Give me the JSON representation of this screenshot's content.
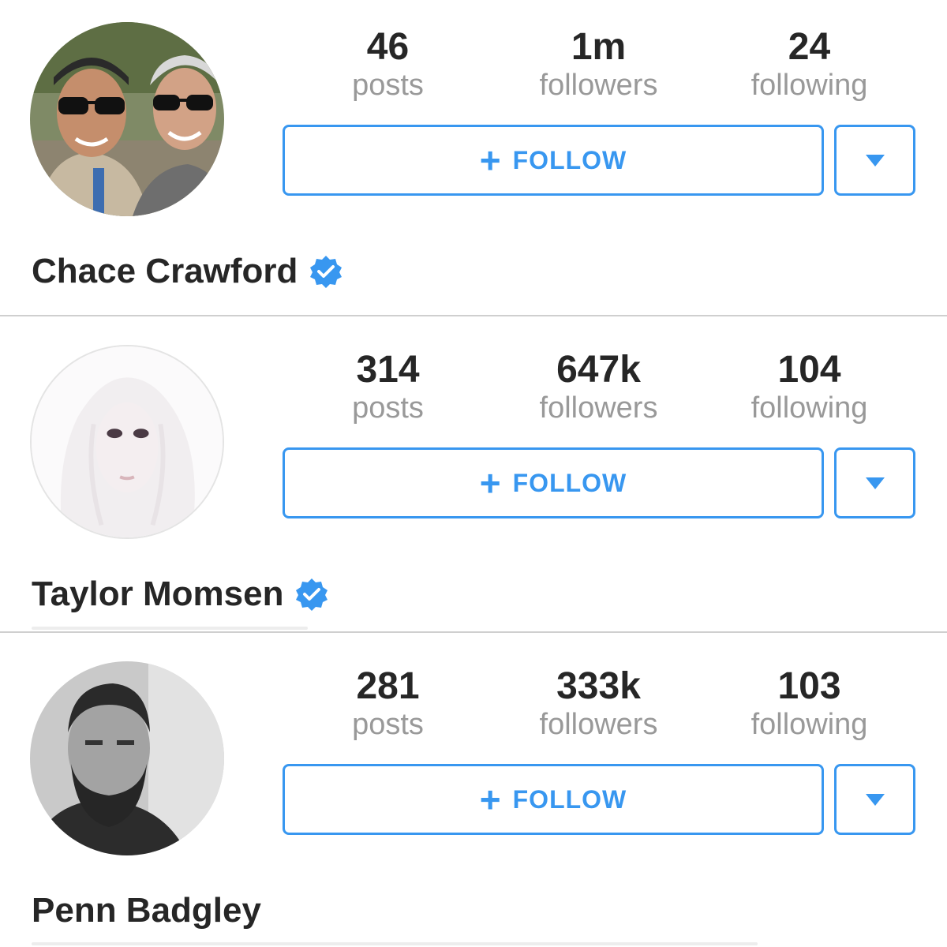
{
  "accent_color": "#3897f0",
  "profiles": [
    {
      "name": "Chace Crawford",
      "verified": true,
      "avatar_icon": "avatar-photo-two-men-sunglasses",
      "stats": [
        {
          "value": "46",
          "label": "posts"
        },
        {
          "value": "1m",
          "label": "followers"
        },
        {
          "value": "24",
          "label": "following"
        }
      ],
      "follow_label": "FOLLOW",
      "follow_icon": "plus-icon",
      "dropdown_icon": "caret-down-icon"
    },
    {
      "name": "Taylor Momsen",
      "verified": true,
      "avatar_icon": "avatar-photo-blonde-woman",
      "stats": [
        {
          "value": "314",
          "label": "posts"
        },
        {
          "value": "647k",
          "label": "followers"
        },
        {
          "value": "104",
          "label": "following"
        }
      ],
      "follow_label": "FOLLOW",
      "follow_icon": "plus-icon",
      "dropdown_icon": "caret-down-icon"
    },
    {
      "name": "Penn Badgley",
      "verified": false,
      "avatar_icon": "avatar-photo-bearded-man-bw",
      "stats": [
        {
          "value": "281",
          "label": "posts"
        },
        {
          "value": "333k",
          "label": "followers"
        },
        {
          "value": "103",
          "label": "following"
        }
      ],
      "follow_label": "FOLLOW",
      "follow_icon": "plus-icon",
      "dropdown_icon": "caret-down-icon"
    }
  ]
}
